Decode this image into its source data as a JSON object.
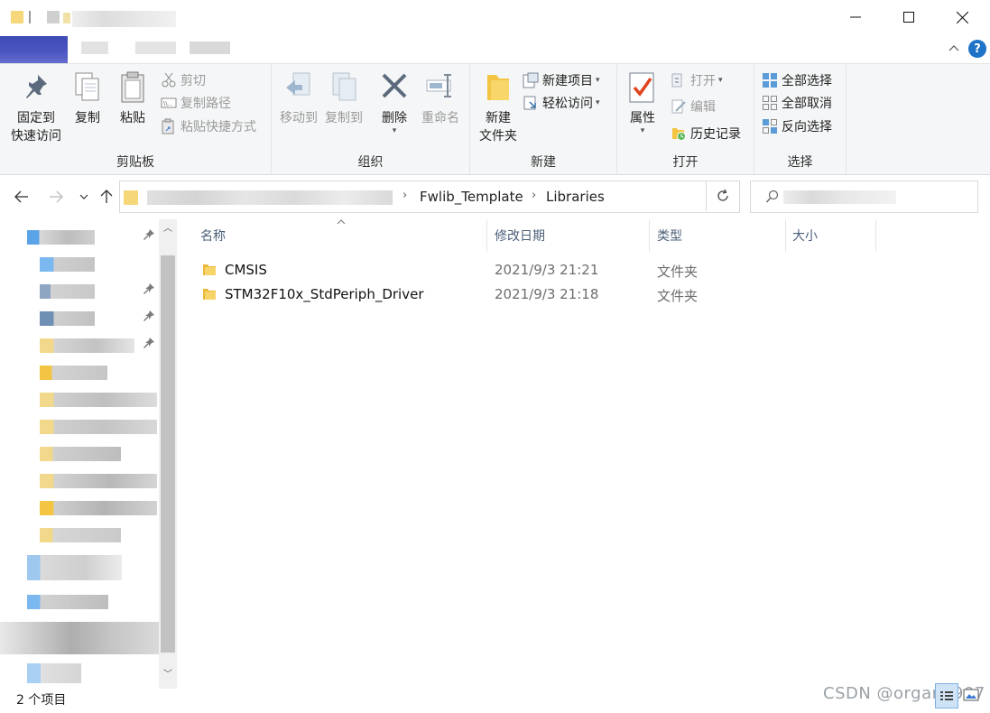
{
  "window": {
    "minimize_icon": "minimize-icon",
    "maximize_icon": "maximize-icon",
    "close_icon": "close-icon"
  },
  "ribbon": {
    "clipboard": {
      "label": "剪贴板",
      "pin": "固定到",
      "pin2": "快速访问",
      "copy": "复制",
      "paste": "粘贴",
      "cut": "剪切",
      "copy_path": "复制路径",
      "paste_shortcut": "粘贴快捷方式"
    },
    "organize": {
      "label": "组织",
      "move_to": "移动到",
      "copy_to": "复制到",
      "delete": "删除",
      "rename": "重命名"
    },
    "new": {
      "label": "新建",
      "new_folder": "新建",
      "new_folder2": "文件夹",
      "new_item": "新建项目",
      "easy_access": "轻松访问"
    },
    "open": {
      "label": "打开",
      "properties": "属性",
      "open": "打开",
      "edit": "编辑",
      "history": "历史记录"
    },
    "select": {
      "label": "选择",
      "select_all": "全部选择",
      "select_none": "全部取消",
      "invert": "反向选择"
    }
  },
  "address": {
    "crumbs": [
      "Fwlib_Template",
      "Libraries"
    ]
  },
  "columns": {
    "name": "名称",
    "date": "修改日期",
    "type": "类型",
    "size": "大小"
  },
  "files": [
    {
      "name": "CMSIS",
      "date": "2021/9/3 21:21",
      "type": "文件夹"
    },
    {
      "name": "STM32F10x_StdPeriph_Driver",
      "date": "2021/9/3 21:18",
      "type": "文件夹"
    }
  ],
  "status": {
    "count": "2 个项目"
  },
  "watermark": "CSDN @organa907",
  "colors": {
    "folder": "#f4c542",
    "accent": "#1e73c8",
    "header_text": "#4c607a"
  }
}
